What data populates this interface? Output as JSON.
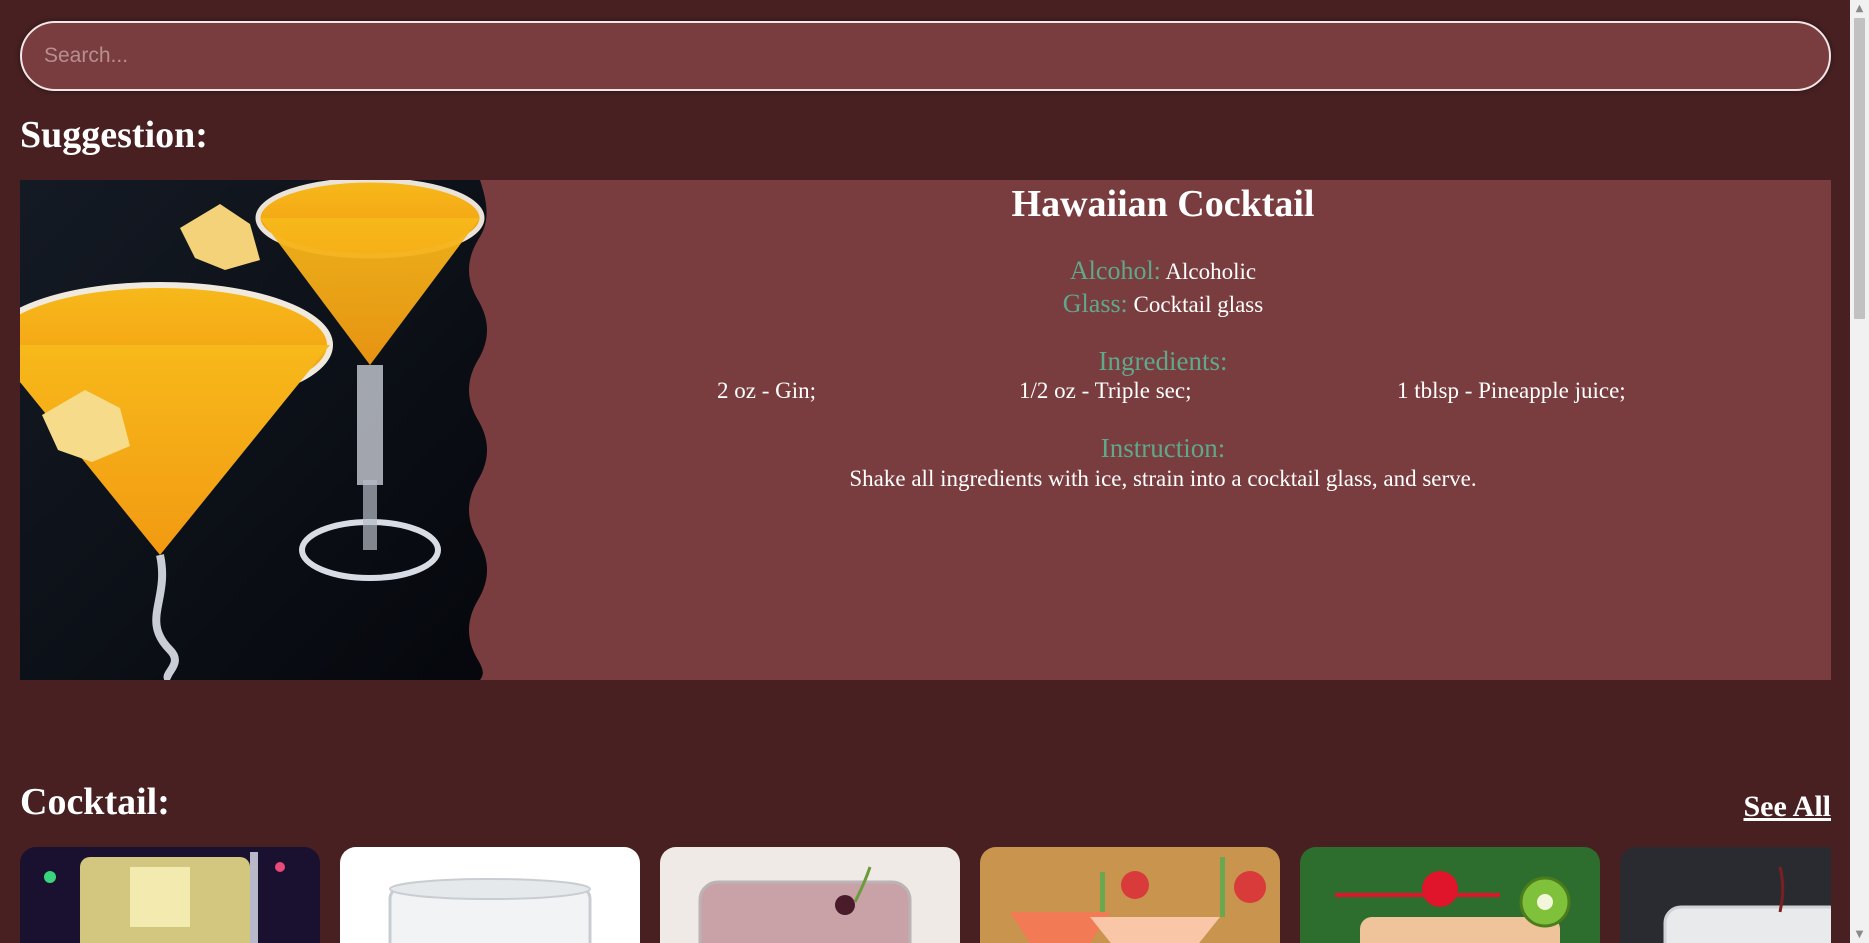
{
  "search": {
    "placeholder": "Search..."
  },
  "suggestion": {
    "heading": "Suggestion:",
    "drink": {
      "name": "Hawaiian Cocktail",
      "alcohol_label": "Alcohol:",
      "alcohol_value": "Alcoholic",
      "glass_label": "Glass:",
      "glass_value": "Cocktail glass",
      "ingredients_label": "Ingredients:",
      "ingredients": [
        "2 oz - Gin;",
        "1/2 oz - Triple sec;",
        "1 tblsp - Pineapple juice;"
      ],
      "instruction_label": "Instruction:",
      "instruction": "Shake all ingredients with ice, strain into a cocktail glass, and serve."
    },
    "image_icon": "cocktail-photo"
  },
  "cocktails": {
    "heading": "Cocktail:",
    "see_all_label": "See All",
    "thumbnails": [
      "cocktail-thumb-1",
      "cocktail-thumb-2",
      "cocktail-thumb-3",
      "cocktail-thumb-4",
      "cocktail-thumb-5",
      "cocktail-thumb-6"
    ]
  },
  "colors": {
    "background": "#482022",
    "card": "#7a3d3f",
    "accent_label": "#5fa88c",
    "text": "#ffffff"
  }
}
